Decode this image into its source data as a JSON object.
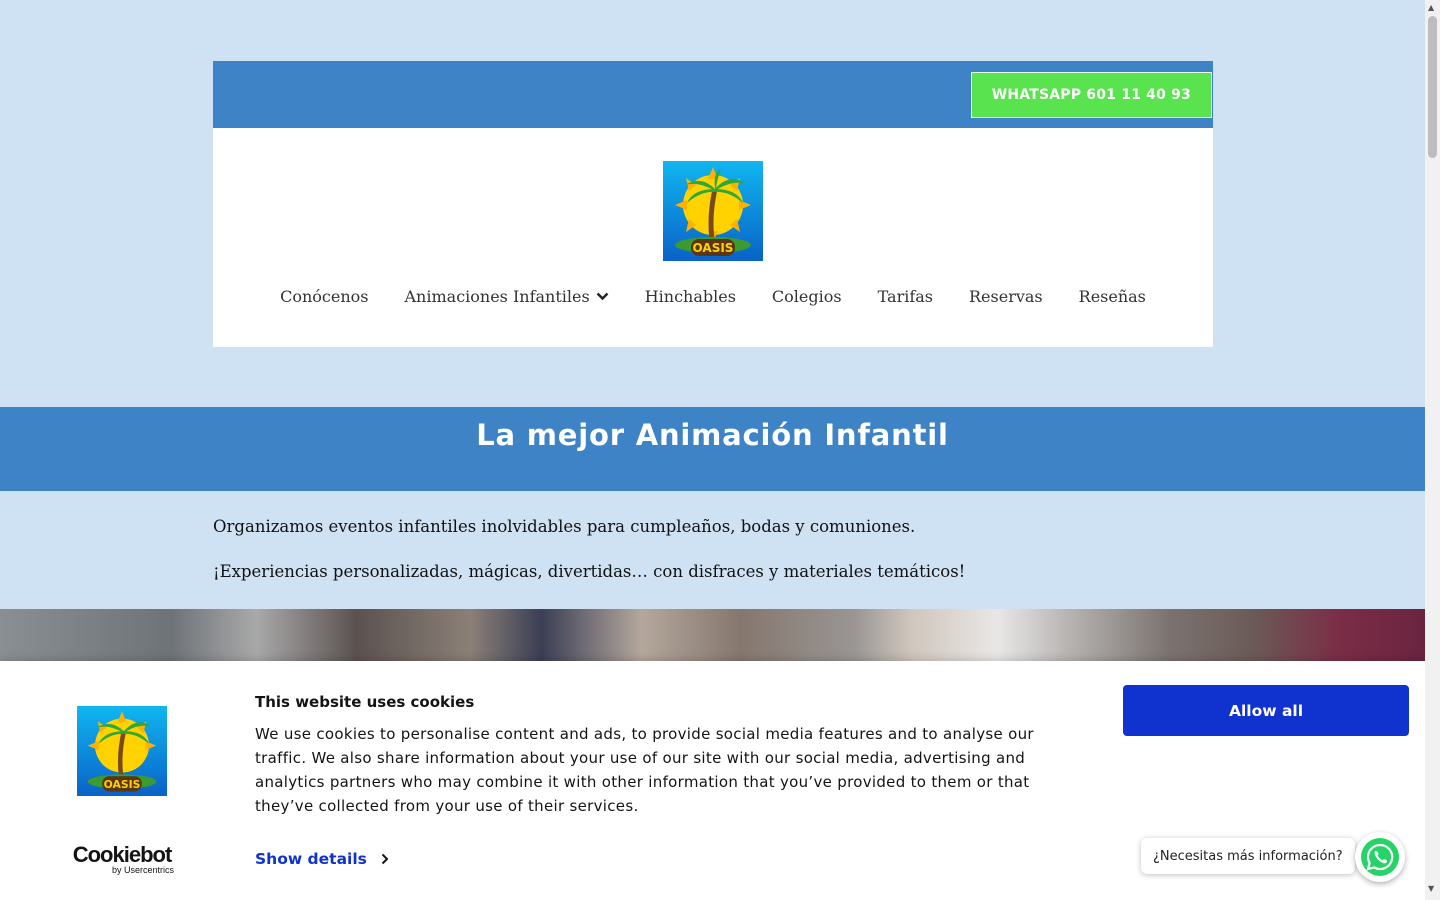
{
  "header": {
    "whatsapp_button": "WHATSAPP 601 11 40 93",
    "logo_text": "OASIS",
    "nav": [
      {
        "label": "Conócenos"
      },
      {
        "label": "Animaciones Infantiles"
      },
      {
        "label": "Hinchables"
      },
      {
        "label": "Colegios"
      },
      {
        "label": "Tarifas"
      },
      {
        "label": "Reservas"
      },
      {
        "label": "Reseñas"
      }
    ]
  },
  "hero": {
    "title": "La mejor Animación Infantil",
    "paragraphs": [
      "Organizamos eventos infantiles inolvidables para cumpleaños, bodas y comuniones.",
      "¡Experiencias personalizadas, mágicas, divertidas… con disfraces y materiales temáticos!"
    ]
  },
  "cookie_banner": {
    "title": "This website uses cookies",
    "text": "We use cookies to personalise content and ads, to provide social media features and to analyse our traffic. We also share information about your use of our site with our social media, advertising and analytics partners who may combine it with other information that you’ve provided to them or that they’ve collected from your use of their services.",
    "show_details": "Show details",
    "allow_all": "Allow all",
    "brand_name": "Cookiebot",
    "brand_sub": "by Usercentrics"
  },
  "whatsapp_widget": {
    "tooltip": "¿Necesitas más información?"
  },
  "colors": {
    "page_bg": "#cfe2f3",
    "brand_blue": "#3e83c6",
    "whatsapp_green": "#58e34f",
    "cookie_blue": "#1032cf"
  }
}
